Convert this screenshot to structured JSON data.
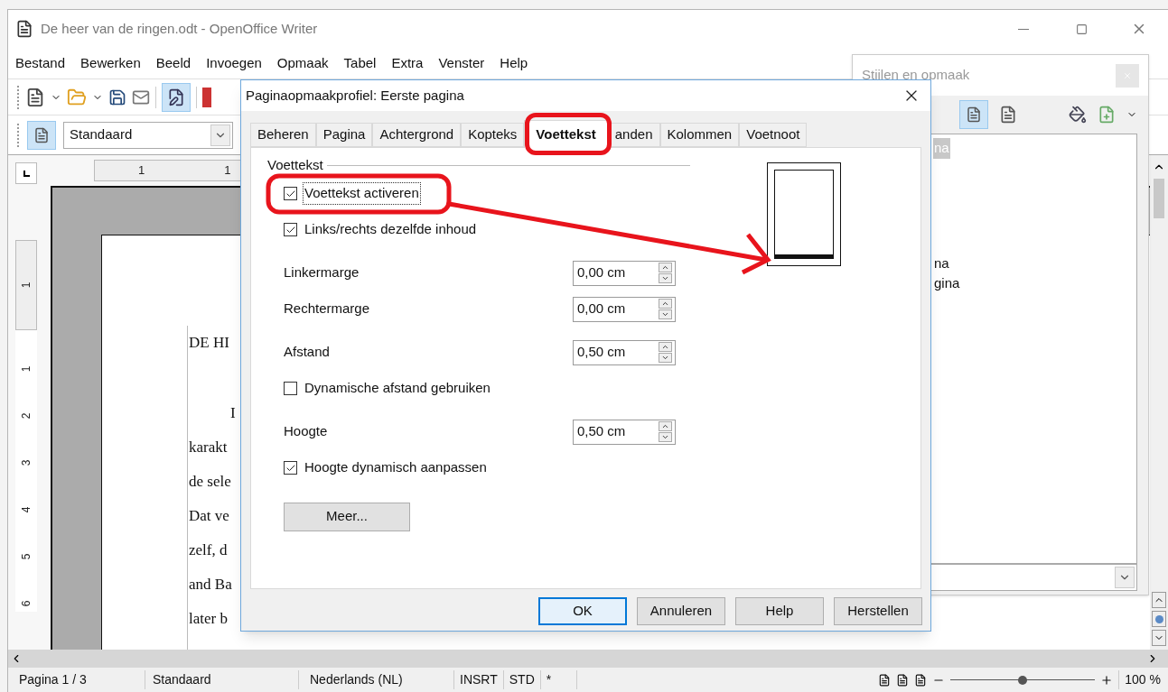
{
  "window": {
    "title": "De heer van de ringen.odt - OpenOffice Writer"
  },
  "menu": [
    "Bestand",
    "Bewerken",
    "Beeld",
    "Invoegen",
    "Opmaak",
    "Tabel",
    "Extra",
    "Venster",
    "Help"
  ],
  "style_box": "Standaard",
  "ruler": {
    "horizontal": [
      "1",
      "1"
    ],
    "vertical": [
      "1",
      "1",
      "2",
      "3",
      "4",
      "5",
      "6"
    ]
  },
  "document": {
    "lines": [
      {
        "text": "DE HI",
        "kind": "plain"
      },
      {
        "text": "I",
        "kind": "indent"
      },
      {
        "text": "karakt",
        "kind": "plain"
      },
      {
        "text": "de sele",
        "kind": "plain"
      },
      {
        "text": "Dat ve",
        "kind": "plain"
      },
      {
        "text": "zelf, d",
        "kind": "plain"
      },
      {
        "text": "and Ba",
        "kind": "plain"
      },
      {
        "text": "later b",
        "kind": "plain"
      }
    ]
  },
  "styles_panel": {
    "title": "Stijlen en opmaak",
    "items": [
      {
        "text": "na",
        "selected": true
      },
      {
        "text": "na",
        "selected": false
      },
      {
        "text": "gina",
        "selected": false
      }
    ]
  },
  "dialog": {
    "title": "Paginaopmaakprofiel: Eerste pagina",
    "tabs": [
      {
        "label": "Beheren",
        "selected": false
      },
      {
        "label": "Pagina",
        "selected": false
      },
      {
        "label": "Achtergrond",
        "selected": false
      },
      {
        "label": "Kopteks",
        "selected": false
      },
      {
        "label": "Voettekst",
        "selected": true
      },
      {
        "label": "anden",
        "selected": false
      },
      {
        "label": "Kolommen",
        "selected": false
      },
      {
        "label": "Voetnoot",
        "selected": false
      }
    ],
    "section": "Voettekst",
    "control_groups": [
      [
        {
          "kind": "checkbox",
          "label": "Voettekst activeren",
          "checked": true,
          "focused": true
        },
        {
          "kind": "checkbox",
          "label": "Links/rechts dezelfde inhoud",
          "checked": true,
          "focused": false
        }
      ],
      [
        {
          "kind": "spin",
          "label": "Linkermarge",
          "value": "0,00 cm"
        },
        {
          "kind": "spin",
          "label": "Rechtermarge",
          "value": "0,00 cm"
        }
      ],
      [
        {
          "kind": "spin",
          "label": "Afstand",
          "value": "0,50 cm"
        },
        {
          "kind": "checkbox",
          "label": "Dynamische afstand gebruiken",
          "checked": false,
          "focused": false
        }
      ],
      [
        {
          "kind": "spin",
          "label": "Hoogte",
          "value": "0,50 cm"
        },
        {
          "kind": "checkbox",
          "label": "Hoogte dynamisch aanpassen",
          "checked": true,
          "focused": false
        }
      ],
      [
        {
          "kind": "button",
          "label": "Meer..."
        }
      ]
    ],
    "buttons": [
      {
        "label": "OK",
        "default": true
      },
      {
        "label": "Annuleren",
        "default": false
      },
      {
        "label": "Help",
        "default": false
      },
      {
        "label": "Herstellen",
        "default": false
      }
    ]
  },
  "status_bar": {
    "page": "Pagina 1 / 3",
    "style": "Standaard",
    "language": "Nederlands (NL)",
    "insert_mode": "INSRT",
    "selection_mode": "STD",
    "modified": "*",
    "zoom": "100 %",
    "zoom_slider": {
      "level": 0.5
    }
  }
}
